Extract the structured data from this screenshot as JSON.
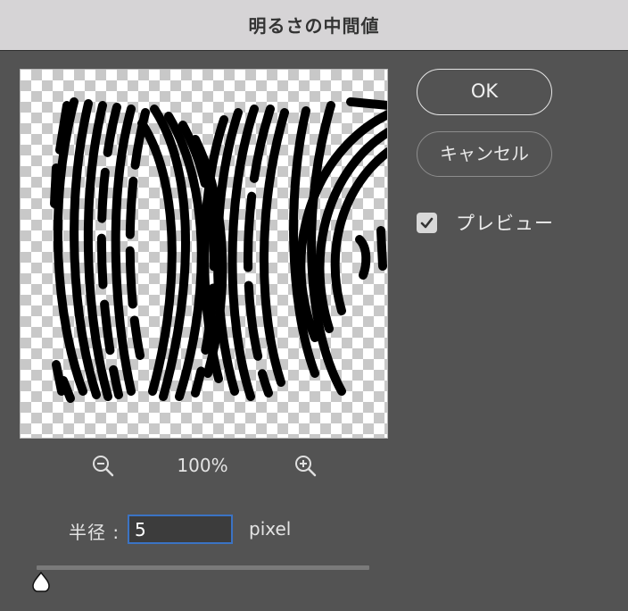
{
  "dialog": {
    "title": "明るさの中間値"
  },
  "buttons": {
    "ok_label": "OK",
    "cancel_label": "キャンセル"
  },
  "preview_option": {
    "label": "プレビュー",
    "checked": true
  },
  "zoom": {
    "level": "100%",
    "zoom_out_icon": "zoom-out-icon",
    "zoom_in_icon": "zoom-in-icon"
  },
  "radius": {
    "label": "半径 :",
    "value": "5",
    "unit": "pixel",
    "slider_fraction": 0.0
  },
  "colors": {
    "dialog_bg": "#535353",
    "titlebar_bg": "#d6d4d6",
    "input_focus": "#3b73c4"
  }
}
